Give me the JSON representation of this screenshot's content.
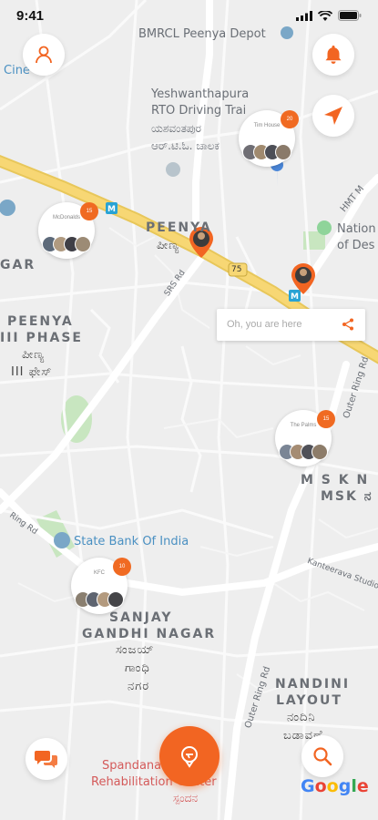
{
  "status_bar": {
    "time": "9:41"
  },
  "map": {
    "poi_labels": {
      "depot": "BMRCL Peenya Depot",
      "cinema": "Cine",
      "rto_1": "Yeshwanthapura",
      "rto_2": "RTO Driving Trai",
      "rto_kn_1": "ಯಶವಂತಪುರ",
      "rto_kn_2": "ಆರ್.ಟಿ.ಓ. ಚಾಲಕ",
      "hmt": "HMT M",
      "nation_1": "Nation",
      "nation_2": "of Des",
      "sbi": "State Bank Of India",
      "spandana_1": "Spandana",
      "spandana_2": "Rehabilitation Center",
      "spandana_kn": "ಸ್ಪಂದನ",
      "srs_rd": "SRS Rd",
      "ring_rd": "Ring Rd",
      "outer_ring_rd": "Outer Ring Rd",
      "kanteerava": "Kanteerava Studio",
      "highway_no": "75"
    },
    "area_labels": {
      "peenya": "PEENYA",
      "peenya_kn": "ಪೀಣ್ಯ",
      "gar": "GAR",
      "peenya3_1": "PEENYA",
      "peenya3_2": "III PHASE",
      "peenya3_kn_1": "ಪೀಣ್ಯ",
      "peenya3_kn_2": "III ಫೇಸ್",
      "msk_1": "M S K N",
      "msk_2": "MSK ನ",
      "sanjay_1": "SANJAY",
      "sanjay_2": "GANDHI NAGAR",
      "sanjay_kn_1": "ಸಂಜಯ್",
      "sanjay_kn_2": "ಗಾಂಧಿ",
      "sanjay_kn_3": "ನಗರ",
      "nandini_1": "NANDINI",
      "nandini_2": "LAYOUT",
      "nandini_kn_1": "ನಂದಿನಿ",
      "nandini_kn_2": "ಬಡಾವಣೆ"
    }
  },
  "clusters": [
    {
      "name": "Tim House",
      "count": "20"
    },
    {
      "name": "McDonalds",
      "count": "15"
    },
    {
      "name": "The Palms",
      "count": "15"
    },
    {
      "name": "KFC",
      "count": "10"
    }
  ],
  "here_card": {
    "text": "Oh, you are here"
  },
  "google_logo": "Google",
  "colors": {
    "accent": "#f26522",
    "highway": "#f7d774",
    "map_bg": "#eeeeee",
    "park": "#c8e6c0"
  },
  "icons": {
    "profile": "person-icon",
    "notifications": "bell-icon",
    "navigate": "navigation-arrow-icon",
    "chat": "chat-bubbles-icon",
    "search": "search-icon",
    "share": "share-icon",
    "center": "location-pin-icon"
  }
}
